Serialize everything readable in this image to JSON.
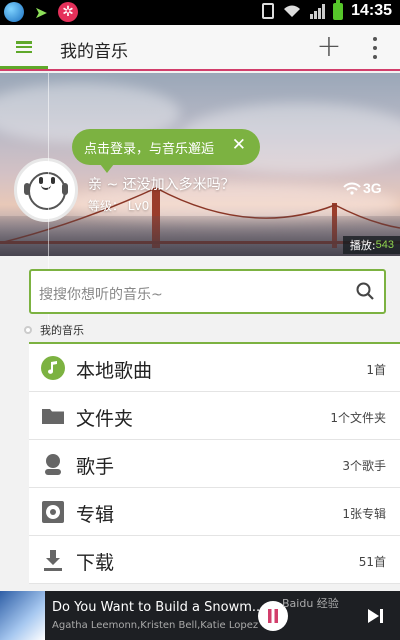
{
  "status_bar": {
    "time": "14:35",
    "network": "3G"
  },
  "header": {
    "title": "我的音乐"
  },
  "banner": {
    "login_prompt": "点击登录，与音乐邂逅",
    "greeting": "亲 ~ 还没加入多米吗？",
    "level": "等级： Lv0",
    "network_label": "3G",
    "plays_label": "播放:",
    "plays_count": "543"
  },
  "search": {
    "placeholder": "搜搜你想听的音乐~"
  },
  "section": {
    "label": "我的音乐"
  },
  "list": [
    {
      "name": "本地歌曲",
      "count": "1首",
      "icon": "music-note-icon"
    },
    {
      "name": "文件夹",
      "count": "1个文件夹",
      "icon": "folder-icon"
    },
    {
      "name": "歌手",
      "count": "3个歌手",
      "icon": "singer-icon"
    },
    {
      "name": "专辑",
      "count": "1张专辑",
      "icon": "album-icon"
    },
    {
      "name": "下载",
      "count": "51首",
      "icon": "download-icon"
    }
  ],
  "player": {
    "song": "Do You Want to Build a Snowm...",
    "artist": "Agatha Leemonn,Kristen Bell,Katie Lopez",
    "watermark": "Baidu 经验"
  },
  "colors": {
    "accent": "#7cb241",
    "title_underline": "#d23e6b",
    "player_bg": "#1d1f23"
  }
}
